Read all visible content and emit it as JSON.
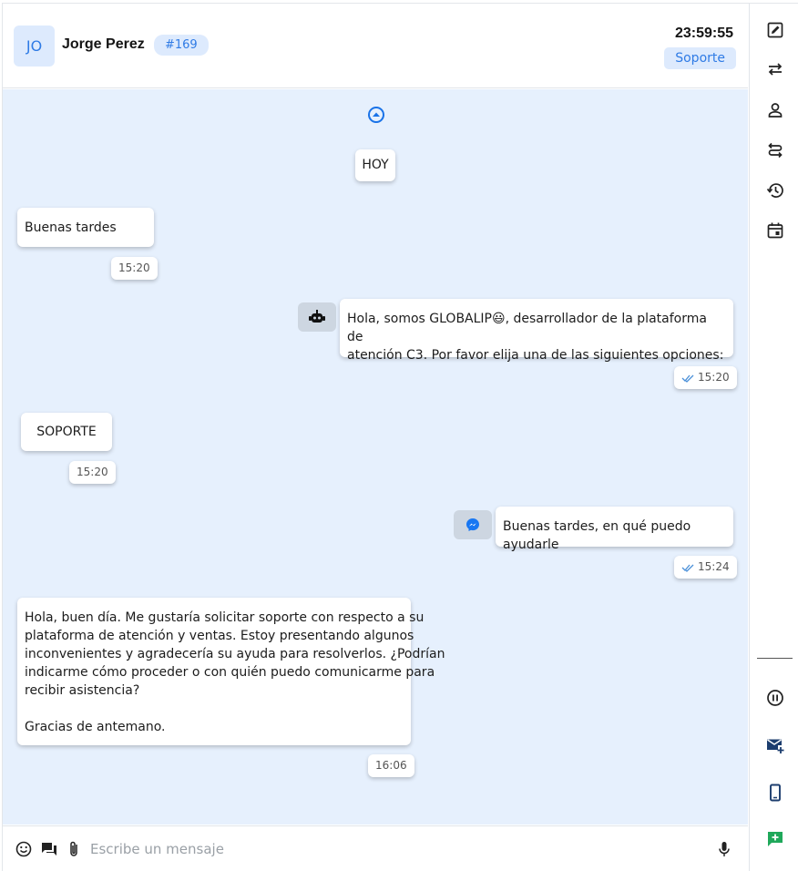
{
  "header": {
    "avatar_initials": "JO",
    "contact_name": "Jorge Perez",
    "ticket_id": "#169",
    "timer": "23:59:55",
    "queue": "Soporte"
  },
  "chat": {
    "date_divider": "HOY",
    "messages": [
      {
        "direction": "incoming",
        "text": "Buenas tardes",
        "time": "15:20"
      },
      {
        "direction": "outgoing",
        "sender": "bot",
        "text_line1": "Hola, somos GLOBALIP",
        "emoji": "😃",
        "text_line1_rest": ", desarrollador de la plataforma de",
        "text_line2": "atención C3. Por favor elija una de las siguientes opciones:",
        "time": "15:20",
        "read": true
      },
      {
        "direction": "incoming",
        "text": "SOPORTE",
        "time": "15:20"
      },
      {
        "direction": "outgoing",
        "sender": "messenger",
        "text": "Buenas tardes, en qué puedo ayudarle",
        "time": "15:24",
        "read": true
      },
      {
        "direction": "incoming",
        "lines": [
          "Hola, buen día. Me gustaría solicitar soporte con respecto a su",
          "plataforma de atención y ventas. Estoy presentando algunos",
          "inconvenientes y agradecería su ayuda para resolverlos. ¿Podrían",
          "indicarme cómo proceder o con quién puedo comunicarme para",
          "recibir asistencia?",
          "",
          "Gracias de antemano."
        ],
        "time": "16:06"
      }
    ]
  },
  "composer": {
    "placeholder": "Escribe un mensaje"
  },
  "colors": {
    "accent": "#2f7be5",
    "chat_bg": "#e6f0fd",
    "badge_bg": "#ddeafd",
    "whatsapp_green": "#1fa85a"
  },
  "toolbar_icons": [
    "edit-icon",
    "transfer-icon",
    "person-icon",
    "route-icon",
    "history-icon",
    "calendar-icon",
    "pause-icon",
    "mail-add-icon",
    "phone-icon",
    "add-chat-icon"
  ]
}
